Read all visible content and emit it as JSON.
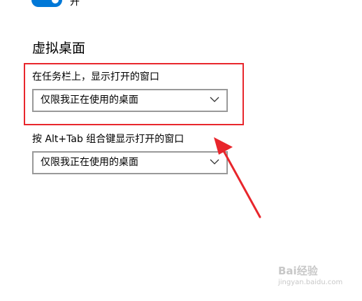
{
  "toggle": {
    "state_label": "开",
    "on": true
  },
  "virtual_desktops": {
    "title": "虚拟桌面",
    "taskbar": {
      "label": "在任务栏上，显示打开的窗口",
      "selected": "仅限我正在使用的桌面"
    },
    "alt_tab": {
      "label": "按 Alt+Tab 组合键显示打开的窗口",
      "selected": "仅限我正在使用的桌面"
    }
  },
  "colors": {
    "accent": "#0078d7",
    "annotation": "#e8262c",
    "dropdown_border": "#999999"
  },
  "watermark": {
    "brand": "Bai经验",
    "url": "jingyan.baidu.com"
  }
}
